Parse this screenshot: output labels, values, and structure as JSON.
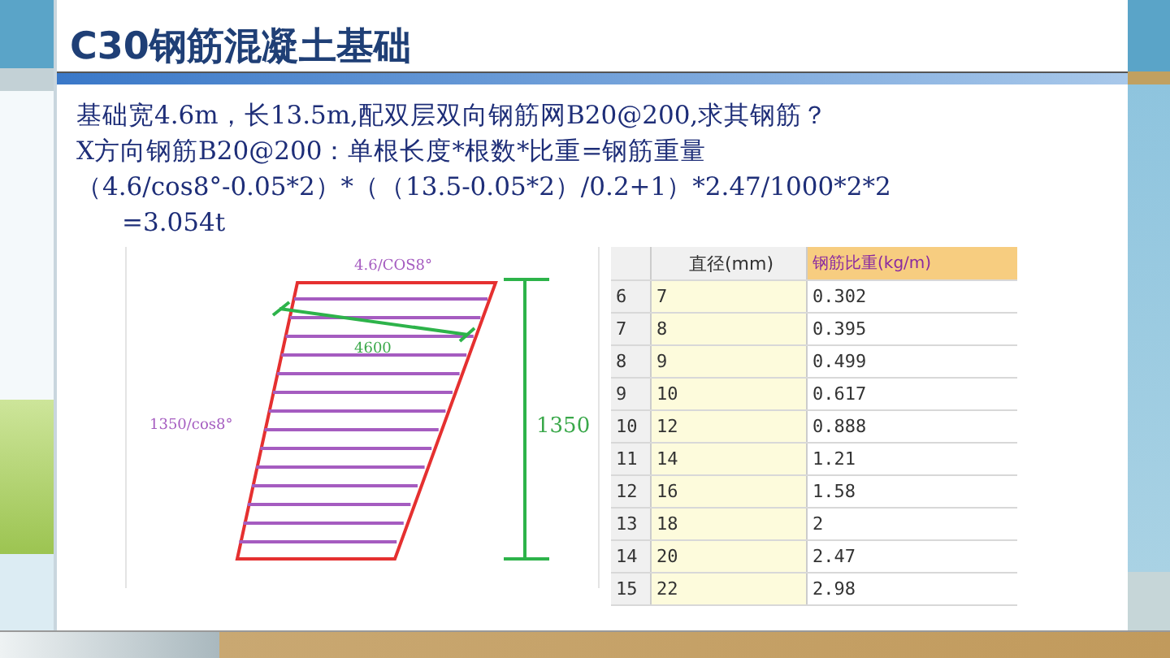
{
  "slide": {
    "title": "C30钢筋混凝土基础",
    "lines": [
      "基础宽4.6m，长13.5m,配双层双向钢筋网B20@200,求其钢筋？",
      "X方向钢筋B20@200：单根长度*根数*比重=钢筋重量",
      "（4.6/cos8°-0.05*2）*（（13.5-0.05*2）/0.2+1）*2.47/1000*2*2",
      "=3.054t"
    ],
    "diagram": {
      "top_label": "4.6/COS8°",
      "inner_label": "4600",
      "side_label": "1350/cos8°",
      "height_label": "1350"
    },
    "table": {
      "columns": [
        "直径(mm)",
        "钢筋比重(kg/m)"
      ],
      "rows": [
        {
          "index": "6",
          "diameter": "7",
          "weight": "0.302"
        },
        {
          "index": "7",
          "diameter": "8",
          "weight": "0.395"
        },
        {
          "index": "8",
          "diameter": "9",
          "weight": "0.499"
        },
        {
          "index": "9",
          "diameter": "10",
          "weight": "0.617"
        },
        {
          "index": "10",
          "diameter": "12",
          "weight": "0.888"
        },
        {
          "index": "11",
          "diameter": "14",
          "weight": "1.21"
        },
        {
          "index": "12",
          "diameter": "16",
          "weight": "1.58"
        },
        {
          "index": "13",
          "diameter": "18",
          "weight": "2"
        },
        {
          "index": "14",
          "diameter": "20",
          "weight": "2.47"
        },
        {
          "index": "15",
          "diameter": "22",
          "weight": "2.98"
        }
      ]
    }
  }
}
